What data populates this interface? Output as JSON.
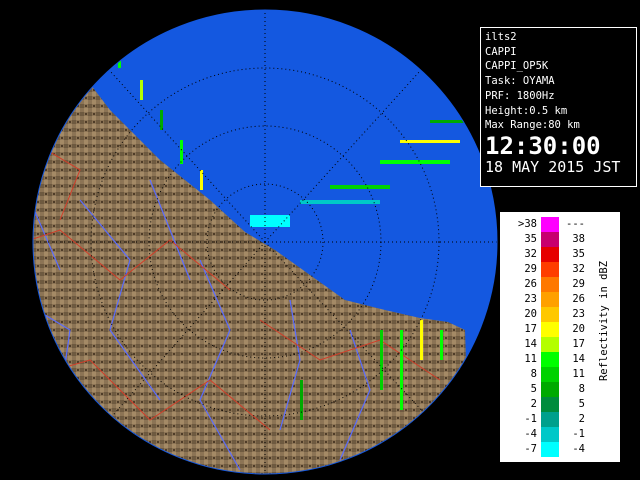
{
  "info": {
    "site": "ilts2",
    "product": "CAPPI",
    "product_code": "CAPPI_OP5K",
    "task": "Task: OYAMA",
    "prf": "PRF: 1800Hz",
    "height": "Height:0.5 km",
    "max_range": "Max Range:80 km",
    "time": "12:30:00",
    "date": "18 MAY 2015 JST"
  },
  "legend": {
    "unit_label": "Reflectivity in dBZ",
    "rows": [
      {
        "lo": ">38",
        "hi": "---",
        "color": "#ff00ff"
      },
      {
        "lo": "35",
        "hi": "38",
        "color": "#c8006e"
      },
      {
        "lo": "32",
        "hi": "35",
        "color": "#e60000"
      },
      {
        "lo": "29",
        "hi": "32",
        "color": "#ff3c00"
      },
      {
        "lo": "26",
        "hi": "29",
        "color": "#ff7800"
      },
      {
        "lo": "23",
        "hi": "26",
        "color": "#ffa000"
      },
      {
        "lo": "20",
        "hi": "23",
        "color": "#ffc800"
      },
      {
        "lo": "17",
        "hi": "20",
        "color": "#ffff00"
      },
      {
        "lo": "14",
        "hi": "17",
        "color": "#b4ff00"
      },
      {
        "lo": "11",
        "hi": "14",
        "color": "#00ff00"
      },
      {
        "lo": "8",
        "hi": "11",
        "color": "#00d200"
      },
      {
        "lo": "5",
        "hi": "8",
        "color": "#00aa00"
      },
      {
        "lo": "2",
        "hi": "5",
        "color": "#008c3c"
      },
      {
        "lo": "-1",
        "hi": "2",
        "color": "#00a08c"
      },
      {
        "lo": "-4",
        "hi": "-1",
        "color": "#00c8c8"
      },
      {
        "lo": "-7",
        "hi": "-4",
        "color": "#00ffff"
      }
    ]
  },
  "map": {
    "sea_color": "#1458e0",
    "background_color": "#000000",
    "land_color": "#8c7455",
    "land_dark_color": "#5a4630",
    "ring_color": "#000000",
    "river_color": "#5a6cff",
    "boundary_color": "#d23c28"
  }
}
